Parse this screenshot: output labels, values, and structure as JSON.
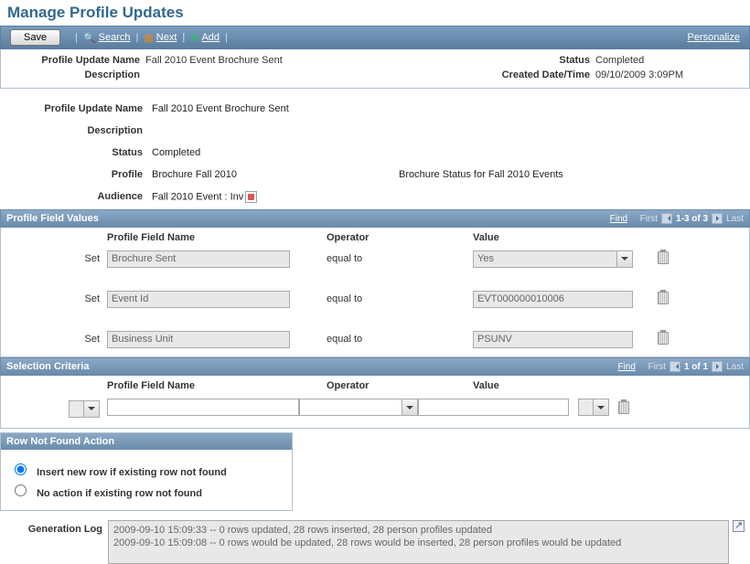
{
  "pageTitle": "Manage Profile Updates",
  "toolbar": {
    "save": "Save",
    "search": "Search",
    "next": "Next",
    "add": "Add",
    "personalize": "Personalize"
  },
  "header": {
    "profileUpdateName_label": "Profile Update Name",
    "profileUpdateName_value": "Fall 2010 Event Brochure Sent",
    "description_label": "Description",
    "description_value": "",
    "status_label": "Status",
    "status_value": "Completed",
    "created_label": "Created Date/Time",
    "created_value": "09/10/2009 3:09PM"
  },
  "details": {
    "profileUpdateName_label": "Profile Update Name",
    "profileUpdateName_value": "Fall 2010 Event Brochure Sent",
    "description_label": "Description",
    "description_value": "",
    "status_label": "Status",
    "status_value": "Completed",
    "profile_label": "Profile",
    "profile_value": "Brochure Fall 2010",
    "profile_desc": "Brochure Status for Fall 2010 Events",
    "audience_label": "Audience",
    "audience_value": "Fall 2010 Event : Inv"
  },
  "pfv": {
    "title": "Profile Field Values",
    "find": "Find",
    "first": "First",
    "range": "1-3 of 3",
    "last": "Last",
    "col_set": "",
    "col_field": "Profile Field Name",
    "col_op": "Operator",
    "col_val": "Value",
    "set_label": "Set",
    "rows": [
      {
        "field": "Brochure Sent",
        "op": "equal to",
        "valueIsSelect": true,
        "value": "Yes"
      },
      {
        "field": "Event Id",
        "op": "equal to",
        "valueIsSelect": false,
        "value": "EVT000000010006"
      },
      {
        "field": "Business Unit",
        "op": "equal to",
        "valueIsSelect": false,
        "value": "PSUNV"
      }
    ]
  },
  "sc": {
    "title": "Selection Criteria",
    "find": "Find",
    "first": "First",
    "range": "1 of 1",
    "last": "Last",
    "col_field": "Profile Field Name",
    "col_op": "Operator",
    "col_val": "Value"
  },
  "rnf": {
    "title": "Row Not Found Action",
    "opt1": "Insert new row if existing row not found",
    "opt2": "No action if existing row not found",
    "selected": "opt1"
  },
  "log": {
    "label": "Generation Log",
    "lines": [
      "2009-09-10 15:09:33 -- 0 rows updated, 28 rows inserted, 28 person profiles updated",
      "2009-09-10 15:09:08 -- 0 rows would be updated, 28 rows would be inserted, 28 person profiles would be updated"
    ]
  }
}
